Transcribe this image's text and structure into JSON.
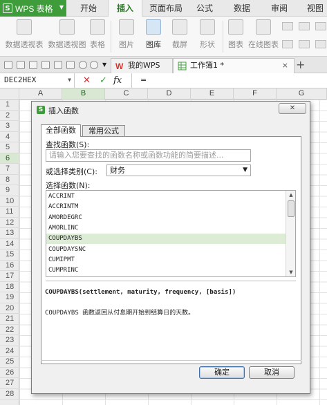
{
  "app": {
    "title": "WPS 表格",
    "logo_glyph": "S"
  },
  "menu": [
    "开始",
    "插入",
    "页面布局",
    "公式",
    "数据",
    "审阅",
    "视图"
  ],
  "ribbon": [
    "数据透视表",
    "数据透视图",
    "表格",
    "图片",
    "图库",
    "截屏",
    "形状",
    "图表",
    "在线图表"
  ],
  "doc_tabs": [
    {
      "label": "我的WPS",
      "close": "×"
    },
    {
      "label": "工作簿1 *",
      "close": "×"
    }
  ],
  "formula_bar": {
    "name_box": "DEC2HEX",
    "cancel": "✕",
    "enter": "✓",
    "fx": "fx",
    "input": "="
  },
  "columns": [
    "A",
    "B",
    "C",
    "D",
    "E",
    "F",
    "G"
  ],
  "rows": [
    "1",
    "2",
    "3",
    "4",
    "5",
    "6",
    "7",
    "8",
    "9",
    "10",
    "11",
    "12",
    "13",
    "14",
    "15",
    "16",
    "17",
    "18",
    "19",
    "20",
    "21",
    "22",
    "23",
    "24",
    "25",
    "26",
    "27",
    "28"
  ],
  "dialog": {
    "title": "插入函数",
    "close_label": "✕",
    "tabs": [
      "全部函数",
      "常用公式"
    ],
    "search_label": "查找函数(S):",
    "search_placeholder": "请输入您要查找的函数名称或函数功能的简要描述...",
    "category_label": "或选择类别(C):",
    "category_value": "财务",
    "select_label": "选择函数(N):",
    "functions": [
      "ACCRINT",
      "ACCRINTM",
      "AMORDEGRC",
      "AMORLINC",
      "COUPDAYBS",
      "COUPDAYSNC",
      "CUMIPMT",
      "CUMPRINC"
    ],
    "selected_function": "COUPDAYBS",
    "syntax": "COUPDAYBS(settlement, maturity, frequency, [basis])",
    "description": "COUPDAYBS 函数返回从付息期开始到结算日的天数。",
    "ok": "确定",
    "cancel": "取消"
  },
  "colors": {
    "accent": "#3e9d3a",
    "selection": "#ddecd5",
    "header_selected": "#d9e8d3"
  }
}
